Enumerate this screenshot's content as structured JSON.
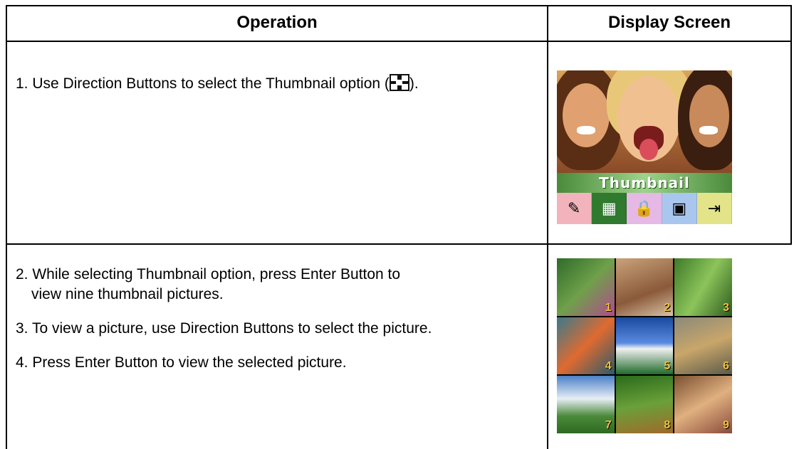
{
  "table": {
    "headers": {
      "operation": "Operation",
      "display": "Display Screen"
    },
    "row1": {
      "step1_before": "1. Use Direction Buttons to select the Thumbnail option (",
      "step1_after": ").",
      "icon": "thumbnail-grid-icon"
    },
    "row2": {
      "step2_line1": "2. While selecting Thumbnail option, press Enter Button to",
      "step2_line2": "view nine thumbnail pictures.",
      "step3": "3. To view a picture, use Direction Buttons to select the picture.",
      "step4": "4. Press Enter Button to view the selected picture."
    }
  },
  "screen1": {
    "label": "Thumbnail",
    "tabs": [
      {
        "icon": "edit-icon",
        "glyph": "✎",
        "color": "#f2b3bd"
      },
      {
        "icon": "thumbnail-icon",
        "glyph": "▦",
        "color": "#2f7a2f"
      },
      {
        "icon": "lock-icon",
        "glyph": "🔒",
        "color": "#e6b8e6"
      },
      {
        "icon": "slideshow-icon",
        "glyph": "▣",
        "color": "#a9c7ee"
      },
      {
        "icon": "exit-icon",
        "glyph": "⇥",
        "color": "#e3e48a"
      }
    ]
  },
  "screen2": {
    "thumbs": [
      {
        "n": "1",
        "bg": "linear-gradient(135deg,#2f6b2a,#6fa04a 50%,#b04a8c)"
      },
      {
        "n": "2",
        "bg": "linear-gradient(160deg,#c9a27a,#8a5a3a 60%,#d9c3a6)"
      },
      {
        "n": "3",
        "bg": "linear-gradient(120deg,#3e7a2a,#8cc45a 50%,#2d5a1e)"
      },
      {
        "n": "4",
        "bg": "linear-gradient(135deg,#3a7a8a,#e06a30 50%,#2a5a6a)"
      },
      {
        "n": "5",
        "bg": "linear-gradient(180deg,#1a4aa0,#5a8ae0 45%,#f0f0f0 55%,#1f6a2a)"
      },
      {
        "n": "6",
        "bg": "linear-gradient(160deg,#8a8a7a,#c9a66a 50%,#5a5a4a)"
      },
      {
        "n": "7",
        "bg": "linear-gradient(180deg,#4a80c8,#e8eef5 40%,#4a8a3a 70%,#2e6a22)"
      },
      {
        "n": "8",
        "bg": "linear-gradient(170deg,#2a6a1a,#6aa03a 50%,#a06a2a)"
      },
      {
        "n": "9",
        "bg": "linear-gradient(150deg,#7a5030,#e0b080 50%,#8a4a3a)"
      }
    ]
  }
}
